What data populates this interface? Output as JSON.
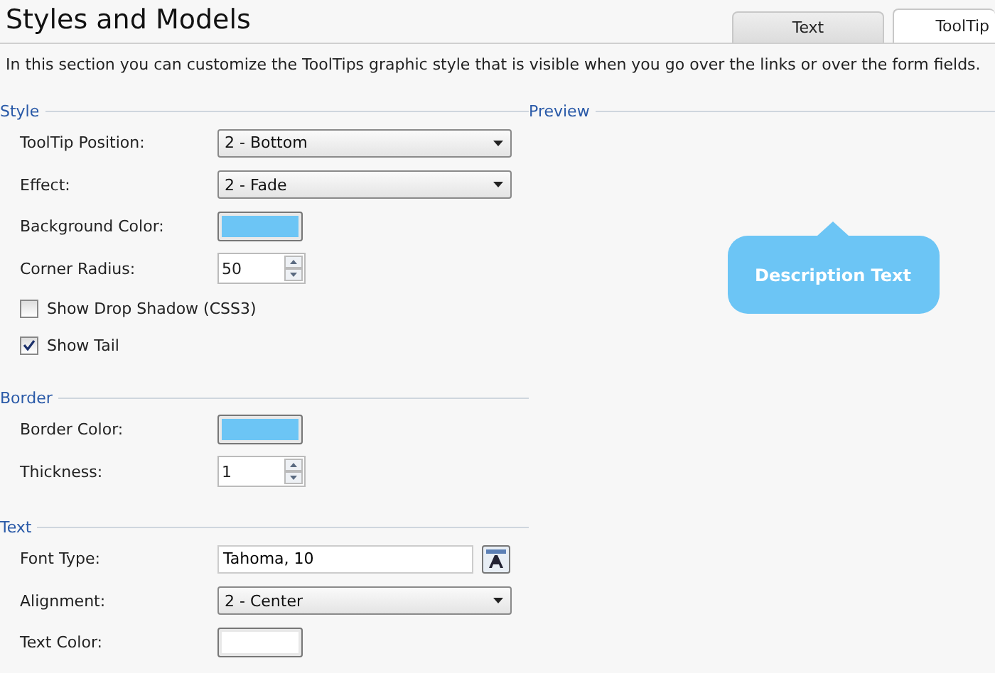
{
  "title": "Styles and Models",
  "tabs": [
    {
      "label": "Text",
      "selected": false
    },
    {
      "label": "ToolTip",
      "selected": true
    }
  ],
  "description": "In this section you can customize the ToolTips graphic style that is visible when you go over the links or over the form fields.",
  "sections": [
    {
      "title": "Style",
      "rows": [
        {
          "kind": "select",
          "label": "ToolTip Position:",
          "value": "2 - Bottom"
        },
        {
          "kind": "select",
          "label": "Effect:",
          "value": "2 - Fade"
        },
        {
          "kind": "color",
          "label": "Background Color:",
          "color": "#6cc5f5"
        },
        {
          "kind": "spinner",
          "label": "Corner Radius:",
          "value": "50"
        },
        {
          "kind": "checkbox",
          "label": "Show Drop Shadow (CSS3)",
          "checked": false
        },
        {
          "kind": "checkbox",
          "label": "Show Tail",
          "checked": true
        }
      ]
    },
    {
      "title": "Border",
      "rows": [
        {
          "kind": "color",
          "label": "Border Color:",
          "color": "#6cc5f5"
        },
        {
          "kind": "spinner",
          "label": "Thickness:",
          "value": "1"
        }
      ]
    },
    {
      "title": "Text",
      "rows": [
        {
          "kind": "font",
          "label": "Font Type:",
          "value": "Tahoma, 10"
        },
        {
          "kind": "select",
          "label": "Alignment:",
          "value": "2 - Center"
        },
        {
          "kind": "color",
          "label": "Text Color:",
          "color": "#ffffff"
        }
      ]
    }
  ],
  "preview": {
    "title": "Preview",
    "text": "Description Text",
    "color": "#6cc5f5",
    "tail": true
  }
}
